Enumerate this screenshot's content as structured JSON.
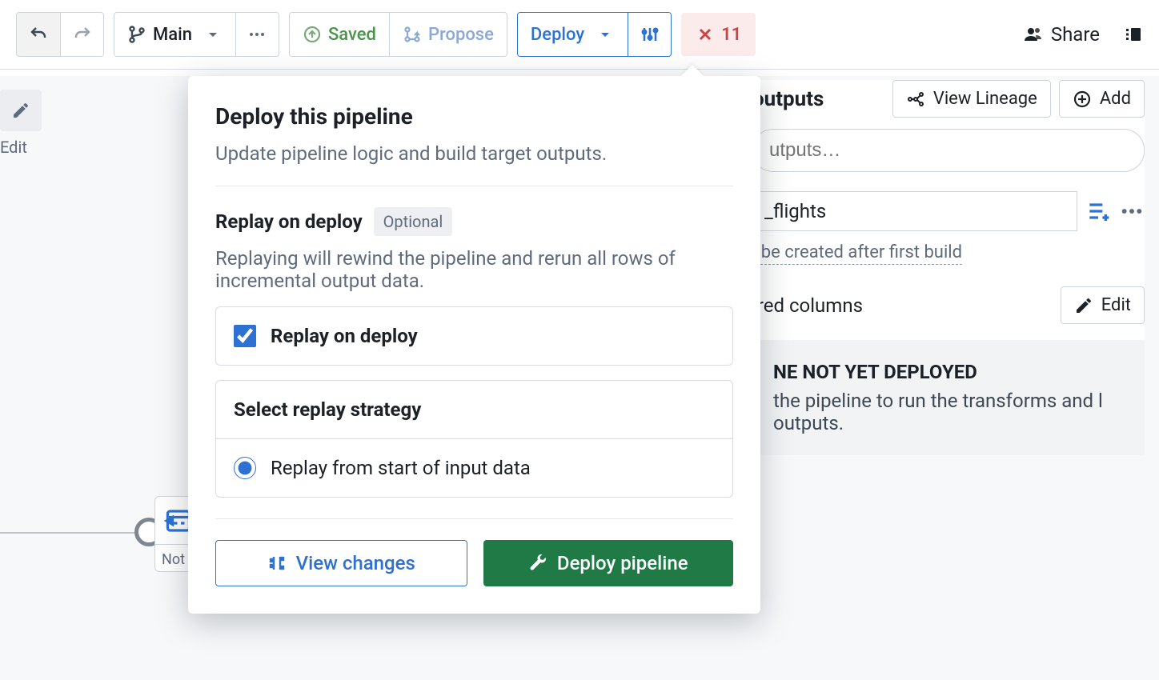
{
  "toolbar": {
    "branch_label": "Main",
    "saved_label": "Saved",
    "propose_label": "Propose",
    "deploy_label": "Deploy",
    "error_count": "11",
    "share_label": "Share"
  },
  "editFloater": {
    "label": "Edit"
  },
  "canvasNode": {
    "label": "Not"
  },
  "rightPanel": {
    "outputs_heading": "outputs",
    "view_lineage_label": "View Lineage",
    "add_label": "Add",
    "search_placeholder": "utputs…",
    "output_name": "_flights",
    "created_hint": "l be created after first build",
    "required_cols_label": "ired columns",
    "edit_label": "Edit",
    "notice_title": "NE NOT YET DEPLOYED",
    "notice_body": "the pipeline to run the transforms and l outputs."
  },
  "popover": {
    "title": "Deploy this pipeline",
    "subtitle": "Update pipeline logic and build target outputs.",
    "replay_heading": "Replay on deploy",
    "replay_tag": "Optional",
    "replay_desc": "Replaying will rewind the pipeline and rerun all rows of incremental output data.",
    "replay_checkbox_label": "Replay on deploy",
    "replay_checked": true,
    "strategy_heading": "Select replay strategy",
    "strategy_option_label": "Replay from start of input data",
    "strategy_selected": true,
    "view_changes_label": "View changes",
    "deploy_button_label": "Deploy pipeline"
  }
}
